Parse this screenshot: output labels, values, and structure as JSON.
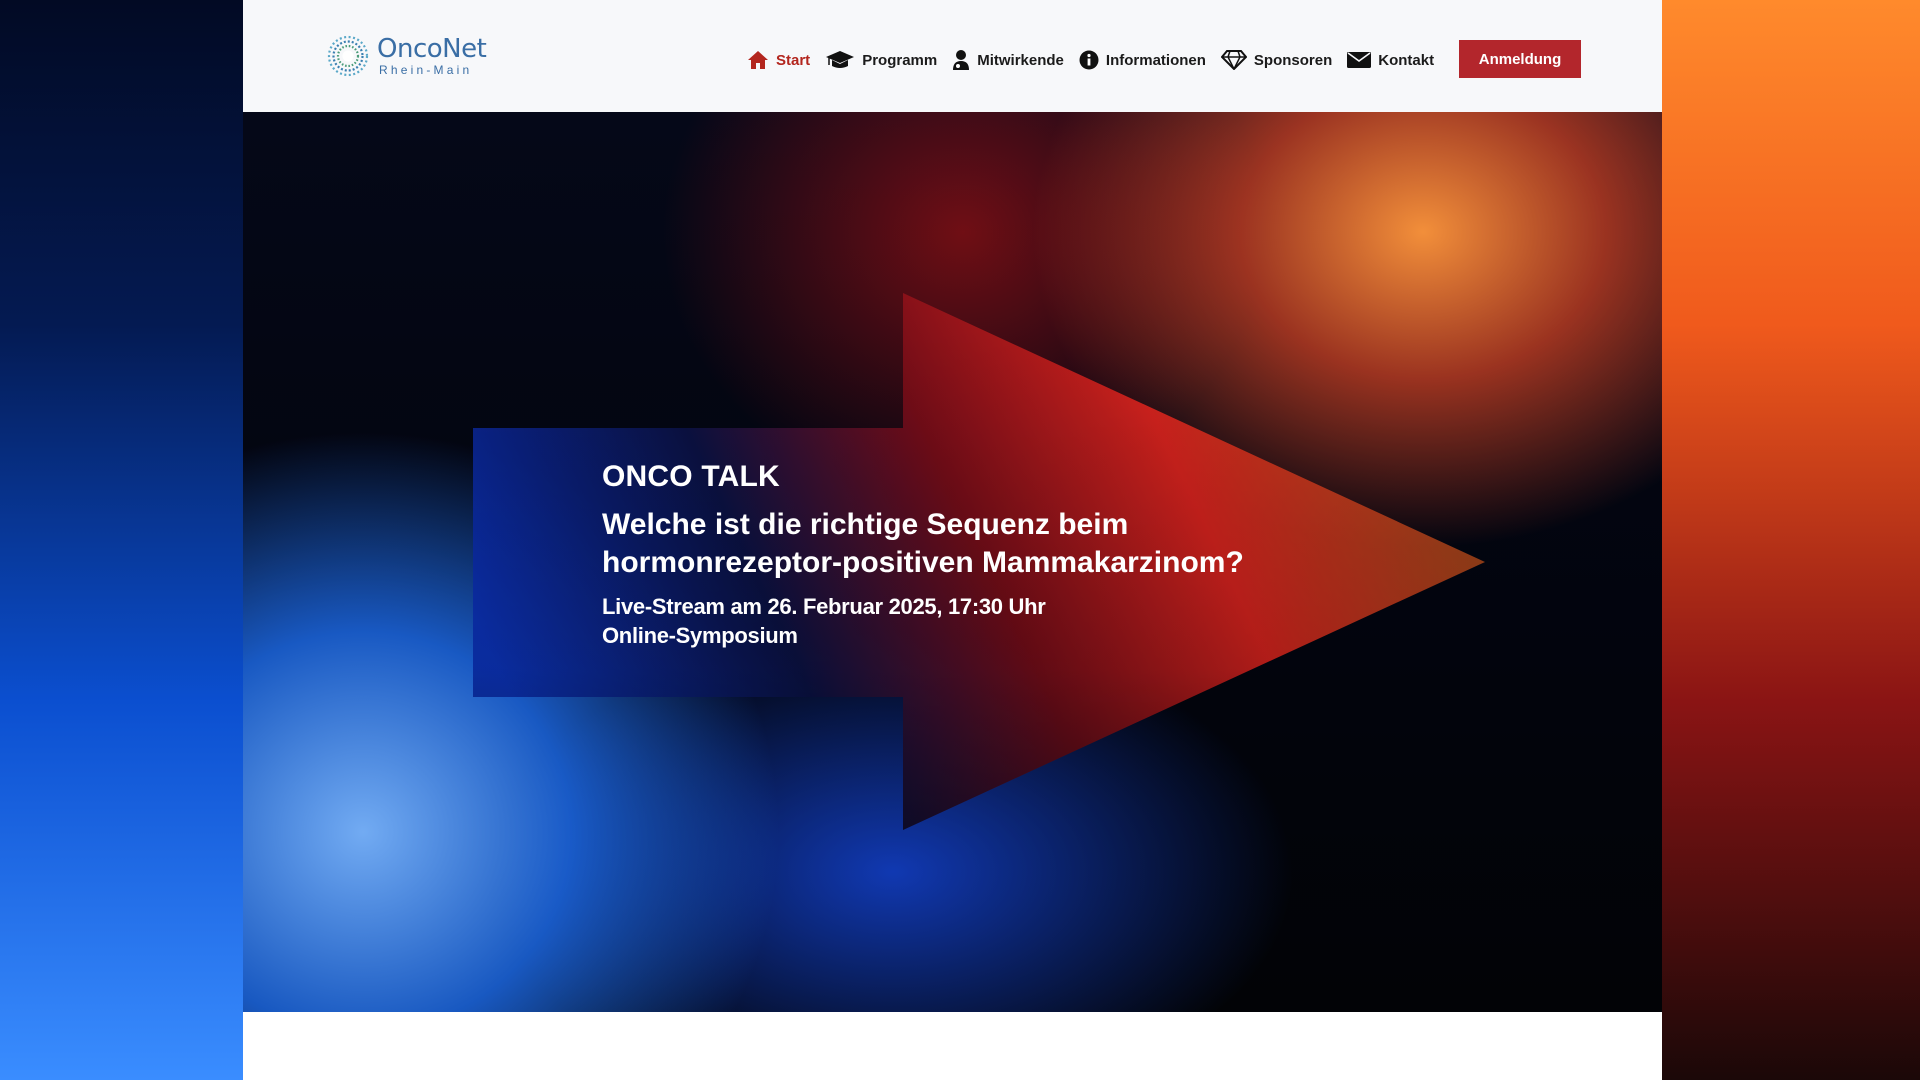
{
  "logo": {
    "title": "OncoNet",
    "subtitle": "Rhein-Main"
  },
  "nav": {
    "items": [
      {
        "label": "Start",
        "icon": "home-icon",
        "active": true
      },
      {
        "label": "Programm",
        "icon": "graduation-cap-icon",
        "active": false
      },
      {
        "label": "Mitwirkende",
        "icon": "user-doctor-icon",
        "active": false
      },
      {
        "label": "Informationen",
        "icon": "info-icon",
        "active": false
      },
      {
        "label": "Sponsoren",
        "icon": "diamond-icon",
        "active": false
      },
      {
        "label": "Kontakt",
        "icon": "envelope-icon",
        "active": false
      }
    ],
    "cta_label": "Anmeldung"
  },
  "hero": {
    "kicker": "ONCO TALK",
    "title_line1": "Welche ist die richtige Sequenz beim",
    "title_line2": "hormonrezeptor-positiven Mammakarzinom?",
    "date_line": "Live-Stream am 26. Februar 2025, 17:30 Uhr",
    "format_line": "Online-Symposium"
  },
  "colors": {
    "accent": "#b3262c",
    "active_nav": "#b3261e",
    "logo": "#3a6ea5"
  }
}
